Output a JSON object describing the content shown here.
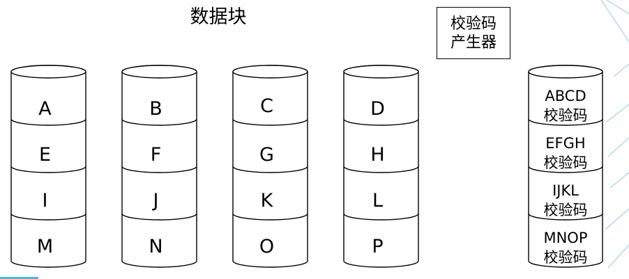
{
  "title": "数据块",
  "generator": {
    "line1": "校验码",
    "line2": "产生器"
  },
  "data_disks": [
    {
      "cells": [
        "A",
        "E",
        "I",
        "M"
      ]
    },
    {
      "cells": [
        "B",
        "F",
        "J",
        "N"
      ]
    },
    {
      "cells": [
        "C",
        "G",
        "K",
        "O"
      ]
    },
    {
      "cells": [
        "D",
        "H",
        "L",
        "P"
      ]
    }
  ],
  "parity_disk": {
    "cells": [
      {
        "top": "ABCD",
        "bottom": "校验码"
      },
      {
        "top": "EFGH",
        "bottom": "校验码"
      },
      {
        "top": "IJKL",
        "bottom": "校验码"
      },
      {
        "top": "MNOP",
        "bottom": "校验码"
      }
    ]
  },
  "colors": {
    "stroke": "#000000",
    "fill": "#ffffff",
    "decor_lines": "#8ec9ea",
    "accent_bar": "#5ab0dd"
  }
}
